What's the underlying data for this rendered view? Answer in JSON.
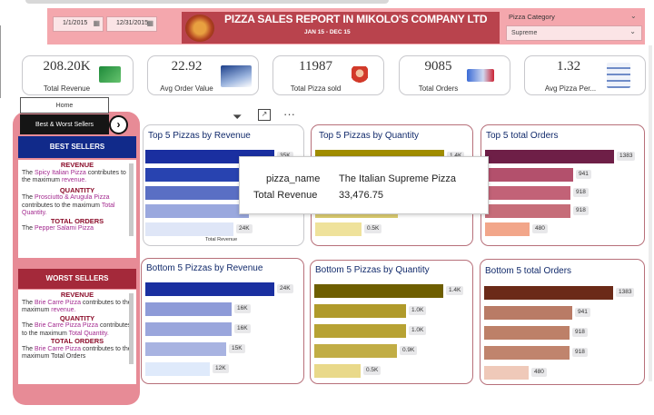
{
  "filters": {
    "start_date": "1/1/2015",
    "end_date": "12/31/2015"
  },
  "header": {
    "title": "PIZZA SALES REPORT IN MIKOLO'S COMPANY LTD",
    "subtitle": "JAN 15 - DEC 15"
  },
  "slicer": {
    "label": "Pizza Category",
    "value": "Supreme"
  },
  "kpis": [
    {
      "value": "208.20K",
      "label": "Total Revenue",
      "icon": "profit-chart-icon"
    },
    {
      "value": "22.92",
      "label": "Avg Order Value",
      "icon": "growth-chart-icon"
    },
    {
      "value": "11987",
      "label": "Total Pizza sold",
      "icon": "pizza-chef-icon"
    },
    {
      "value": "9085",
      "label": "Total Orders",
      "icon": "order-card-icon"
    },
    {
      "value": "1.32",
      "label": "Avg Pizza Per...",
      "icon": "flowchart-icon"
    }
  ],
  "nav": {
    "home": "Home",
    "best_worst": "Best & Worst Sellers"
  },
  "best": {
    "title": "BEST SELLERS",
    "revenue_h": "REVENUE",
    "revenue_pre": "The ",
    "revenue_name": "Spicy Italian Pizza",
    "revenue_mid": " contributes to the maximum ",
    "revenue_end": "revenue.",
    "qty_h": "QUANTITY",
    "qty_pre": "The ",
    "qty_name": "Prosciutto & Arugula  Pizza",
    "qty_mid": " contributes to the maximum ",
    "qty_end": "Total Quantity.",
    "orders_h": "TOTAL ORDERS",
    "orders_pre": "The ",
    "orders_name": "Pepper Salami Pizza"
  },
  "worst": {
    "title": "WORST SELLERS",
    "revenue_h": "REVENUE",
    "revenue_pre": "The ",
    "revenue_name": "Brie Carre Pizza",
    "revenue_mid": " contributes to the maximum ",
    "revenue_end": "revenue.",
    "qty_h": "QUANTITY",
    "qty_pre": "The  ",
    "qty_name": "Brie Carre Pizza  Pizza",
    "qty_mid": " contributes to the maximum  ",
    "qty_end": "Total Quantity.",
    "orders_h": "TOTAL ORDERS",
    "orders_pre": "The  ",
    "orders_name": "Brie Carre Pizza",
    "orders_end": " contributes to the maximum  Total Orders"
  },
  "visual_header": {
    "filter_icon": "filter-icon",
    "focus_icon": "focus-mode-icon",
    "more_icon": "more-options-icon"
  },
  "tooltip": {
    "k1": "pizza_name",
    "v1": "The Italian Supreme Pizza",
    "k2": "Total Revenue",
    "v2": "33,476.75"
  },
  "chart_data": [
    {
      "type": "bar",
      "title": "Top 5 Pizzas by Revenue",
      "xlabel": "Total Revenue",
      "values": [
        35,
        32,
        30,
        28,
        24
      ],
      "labels": [
        "35K",
        "",
        "",
        "",
        "24K"
      ],
      "colors": [
        "#1a2fa0",
        "#2843b0",
        "#5a6fc4",
        "#9aa8de",
        "#dfe6f7"
      ]
    },
    {
      "type": "bar",
      "title": "Top 5 Pizzas by Quantity",
      "values": [
        1.4,
        1.2,
        1.1,
        0.9,
        0.5
      ],
      "labels": [
        "1.4K",
        "",
        "",
        "",
        "0.5K"
      ],
      "colors": [
        "#a18d00",
        "#b9a400",
        "#c9b62e",
        "#dccd71",
        "#efe29b"
      ]
    },
    {
      "type": "bar",
      "title": "Top 5 total Orders",
      "values": [
        1383,
        941,
        918,
        918,
        480
      ],
      "labels": [
        "1383",
        "941",
        "918",
        "918",
        "480"
      ],
      "colors": [
        "#6e1f47",
        "#b3506c",
        "#c26277",
        "#c66d79",
        "#f2a68a"
      ]
    },
    {
      "type": "bar",
      "title": "Bottom 5 Pizzas by Revenue",
      "values": [
        24,
        16,
        16,
        15,
        12
      ],
      "labels": [
        "24K",
        "16K",
        "16K",
        "15K",
        "12K"
      ],
      "colors": [
        "#1a2fa0",
        "#8e9bd8",
        "#9aa6dc",
        "#a8b3e1",
        "#dfeafb"
      ]
    },
    {
      "type": "bar",
      "title": "Bottom 5 Pizzas by Quantity",
      "values": [
        1.4,
        1.0,
        1.0,
        0.9,
        0.5
      ],
      "labels": [
        "1.4K",
        "1.0K",
        "1.0K",
        "0.9K",
        "0.5K"
      ],
      "colors": [
        "#6e5e00",
        "#b09a2a",
        "#b7a233",
        "#c1ad45",
        "#e9d98a"
      ]
    },
    {
      "type": "bar",
      "title": "Bottom 5 total Orders",
      "values": [
        1383,
        941,
        918,
        918,
        480
      ],
      "labels": [
        "1383",
        "941",
        "918",
        "918",
        "480"
      ],
      "colors": [
        "#6b2a18",
        "#b97b66",
        "#bd8068",
        "#c0846d",
        "#efc9b9"
      ]
    }
  ]
}
